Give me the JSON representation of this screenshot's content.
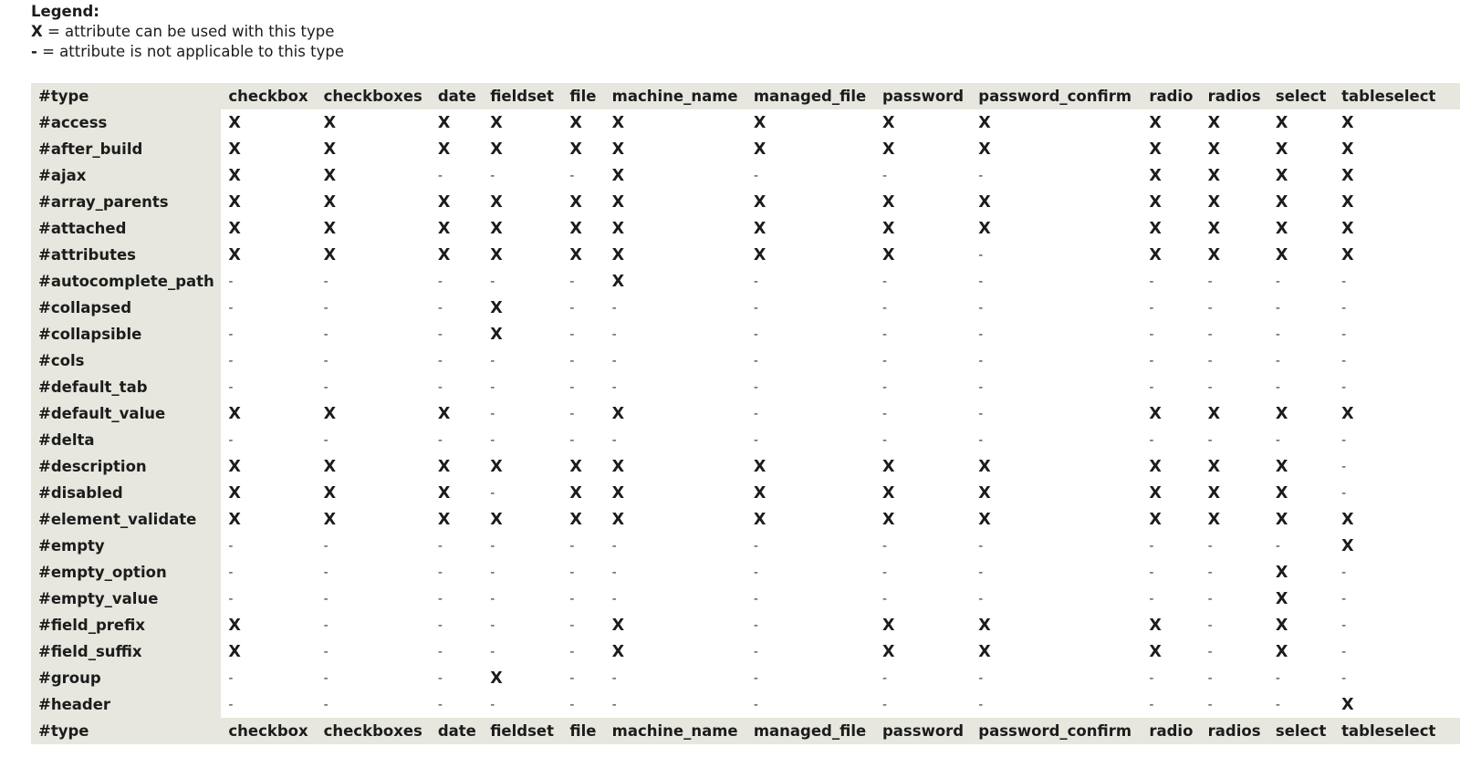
{
  "legend": {
    "title": "Legend:",
    "yes_symbol": "X",
    "yes_text": " = attribute can be used with this type",
    "no_symbol": "-",
    "no_text": " = attribute is not applicable to this type"
  },
  "table": {
    "corner_label": "#type",
    "columns": [
      "checkbox",
      "checkboxes",
      "date",
      "fieldset",
      "file",
      "machine_name",
      "managed_file",
      "password",
      "password_confirm",
      "radio",
      "radios",
      "select",
      "tableselect"
    ],
    "rows": [
      {
        "attr": "#access",
        "values": [
          "X",
          "X",
          "X",
          "X",
          "X",
          "X",
          "X",
          "X",
          "X",
          "X",
          "X",
          "X",
          "X"
        ]
      },
      {
        "attr": "#after_build",
        "values": [
          "X",
          "X",
          "X",
          "X",
          "X",
          "X",
          "X",
          "X",
          "X",
          "X",
          "X",
          "X",
          "X"
        ]
      },
      {
        "attr": "#ajax",
        "values": [
          "X",
          "X",
          "-",
          "-",
          "-",
          "X",
          "-",
          "-",
          "-",
          "X",
          "X",
          "X",
          "X"
        ]
      },
      {
        "attr": "#array_parents",
        "values": [
          "X",
          "X",
          "X",
          "X",
          "X",
          "X",
          "X",
          "X",
          "X",
          "X",
          "X",
          "X",
          "X"
        ]
      },
      {
        "attr": "#attached",
        "values": [
          "X",
          "X",
          "X",
          "X",
          "X",
          "X",
          "X",
          "X",
          "X",
          "X",
          "X",
          "X",
          "X"
        ]
      },
      {
        "attr": "#attributes",
        "values": [
          "X",
          "X",
          "X",
          "X",
          "X",
          "X",
          "X",
          "X",
          "-",
          "X",
          "X",
          "X",
          "X"
        ]
      },
      {
        "attr": "#autocomplete_path",
        "values": [
          "-",
          "-",
          "-",
          "-",
          "-",
          "X",
          "-",
          "-",
          "-",
          "-",
          "-",
          "-",
          "-"
        ]
      },
      {
        "attr": "#collapsed",
        "values": [
          "-",
          "-",
          "-",
          "X",
          "-",
          "-",
          "-",
          "-",
          "-",
          "-",
          "-",
          "-",
          "-"
        ]
      },
      {
        "attr": "#collapsible",
        "values": [
          "-",
          "-",
          "-",
          "X",
          "-",
          "-",
          "-",
          "-",
          "-",
          "-",
          "-",
          "-",
          "-"
        ]
      },
      {
        "attr": "#cols",
        "values": [
          "-",
          "-",
          "-",
          "-",
          "-",
          "-",
          "-",
          "-",
          "-",
          "-",
          "-",
          "-",
          "-"
        ]
      },
      {
        "attr": "#default_tab",
        "values": [
          "-",
          "-",
          "-",
          "-",
          "-",
          "-",
          "-",
          "-",
          "-",
          "-",
          "-",
          "-",
          "-"
        ]
      },
      {
        "attr": "#default_value",
        "values": [
          "X",
          "X",
          "X",
          "-",
          "-",
          "X",
          "-",
          "-",
          "-",
          "X",
          "X",
          "X",
          "X"
        ]
      },
      {
        "attr": "#delta",
        "values": [
          "-",
          "-",
          "-",
          "-",
          "-",
          "-",
          "-",
          "-",
          "-",
          "-",
          "-",
          "-",
          "-"
        ]
      },
      {
        "attr": "#description",
        "values": [
          "X",
          "X",
          "X",
          "X",
          "X",
          "X",
          "X",
          "X",
          "X",
          "X",
          "X",
          "X",
          "-"
        ]
      },
      {
        "attr": "#disabled",
        "values": [
          "X",
          "X",
          "X",
          "-",
          "X",
          "X",
          "X",
          "X",
          "X",
          "X",
          "X",
          "X",
          "-"
        ]
      },
      {
        "attr": "#element_validate",
        "values": [
          "X",
          "X",
          "X",
          "X",
          "X",
          "X",
          "X",
          "X",
          "X",
          "X",
          "X",
          "X",
          "X"
        ]
      },
      {
        "attr": "#empty",
        "values": [
          "-",
          "-",
          "-",
          "-",
          "-",
          "-",
          "-",
          "-",
          "-",
          "-",
          "-",
          "-",
          "X"
        ]
      },
      {
        "attr": "#empty_option",
        "values": [
          "-",
          "-",
          "-",
          "-",
          "-",
          "-",
          "-",
          "-",
          "-",
          "-",
          "-",
          "X",
          "-"
        ]
      },
      {
        "attr": "#empty_value",
        "values": [
          "-",
          "-",
          "-",
          "-",
          "-",
          "-",
          "-",
          "-",
          "-",
          "-",
          "-",
          "X",
          "-"
        ]
      },
      {
        "attr": "#field_prefix",
        "values": [
          "X",
          "-",
          "-",
          "-",
          "-",
          "X",
          "-",
          "X",
          "X",
          "X",
          "-",
          "X",
          "-"
        ]
      },
      {
        "attr": "#field_suffix",
        "values": [
          "X",
          "-",
          "-",
          "-",
          "-",
          "X",
          "-",
          "X",
          "X",
          "X",
          "-",
          "X",
          "-"
        ]
      },
      {
        "attr": "#group",
        "values": [
          "-",
          "-",
          "-",
          "X",
          "-",
          "-",
          "-",
          "-",
          "-",
          "-",
          "-",
          "-",
          "-"
        ]
      },
      {
        "attr": "#header",
        "values": [
          "-",
          "-",
          "-",
          "-",
          "-",
          "-",
          "-",
          "-",
          "-",
          "-",
          "-",
          "-",
          "X"
        ]
      }
    ]
  }
}
